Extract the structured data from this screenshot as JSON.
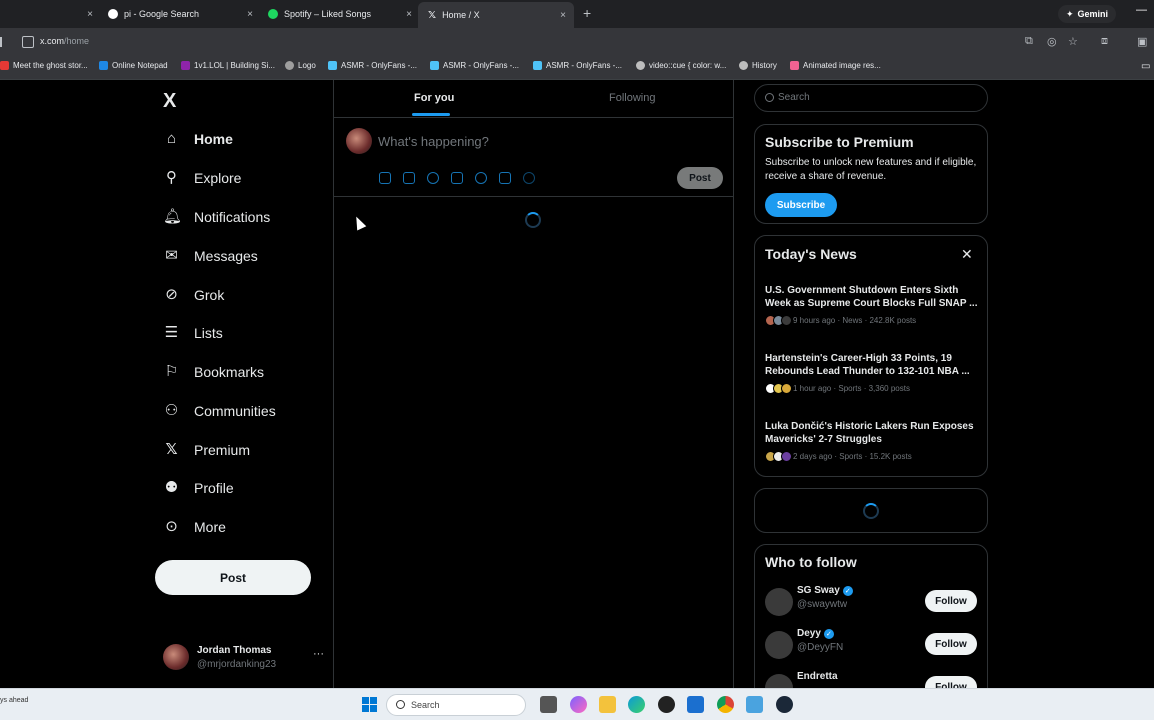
{
  "browser": {
    "tabs": [
      {
        "label": "",
        "close": "×"
      },
      {
        "label": "pi - Google Search",
        "close": "×"
      },
      {
        "label": "Spotify – Liked Songs",
        "close": "×"
      },
      {
        "label": "Home / X",
        "close": "×"
      }
    ],
    "new_tab": "+",
    "gemini_label": "Gemini",
    "url_host": "x.com",
    "url_path": "/home",
    "bookmarks": [
      "Meet the ghost stor...",
      "Online Notepad",
      "1v1.LOL | Building Si...",
      "Logo",
      "ASMR - OnlyFans -...",
      "ASMR - OnlyFans -...",
      "ASMR - OnlyFans -...",
      "video::cue { color: w...",
      "History",
      "Animated image res..."
    ]
  },
  "nav": {
    "logo": "X",
    "items": [
      {
        "label": "Home",
        "icon": "home-icon"
      },
      {
        "label": "Explore",
        "icon": "search-icon"
      },
      {
        "label": "Notifications",
        "icon": "bell-icon"
      },
      {
        "label": "Messages",
        "icon": "envelope-icon"
      },
      {
        "label": "Grok",
        "icon": "grok-icon"
      },
      {
        "label": "Lists",
        "icon": "list-icon"
      },
      {
        "label": "Bookmarks",
        "icon": "bookmark-icon"
      },
      {
        "label": "Communities",
        "icon": "people-icon"
      },
      {
        "label": "Premium",
        "icon": "x-icon"
      },
      {
        "label": "Profile",
        "icon": "person-icon"
      },
      {
        "label": "More",
        "icon": "more-circle-icon"
      }
    ],
    "post_label": "Post",
    "account": {
      "name": "Jordan Thomas",
      "handle": "@mrjordanking23",
      "more": "···"
    }
  },
  "feed": {
    "tabs": [
      "For you",
      "Following"
    ],
    "active_tab": "For you",
    "composer_placeholder": "What's happening?",
    "post_label": "Post"
  },
  "sidebar": {
    "search_placeholder": "Search",
    "premium": {
      "title": "Subscribe to Premium",
      "description": "Subscribe to unlock new features and if eligible, receive a share of revenue.",
      "button": "Subscribe"
    },
    "news": {
      "title": "Today's News",
      "close": "✕",
      "items": [
        {
          "headline": "U.S. Government Shutdown Enters Sixth Week as Supreme Court Blocks Full SNAP ...",
          "meta": "9 hours ago · News · 242.8K posts"
        },
        {
          "headline": "Hartenstein's Career-High 33 Points, 19 Rebounds Lead Thunder to 132-101 NBA ...",
          "meta": "1 hour ago · Sports · 3,360 posts"
        },
        {
          "headline": "Luka Dončić's Historic Lakers Run Exposes Mavericks' 2-7 Struggles",
          "meta": "2 days ago · Sports · 15.2K posts"
        }
      ]
    },
    "who_to_follow": {
      "title": "Who to follow",
      "follow_label": "Follow",
      "people": [
        {
          "name": "SG Sway",
          "handle": "@swaywtw",
          "verified": true
        },
        {
          "name": "Deyy",
          "handle": "@DeyyFN",
          "verified": true
        },
        {
          "name": "Endretta",
          "handle": "",
          "verified": false
        }
      ]
    }
  },
  "taskbar": {
    "status_text": "ys ahead",
    "search_placeholder": "Search"
  },
  "colors": {
    "accent": "#1d9bf0",
    "background": "#000000",
    "border": "#2f3336",
    "muted": "#71767b"
  }
}
